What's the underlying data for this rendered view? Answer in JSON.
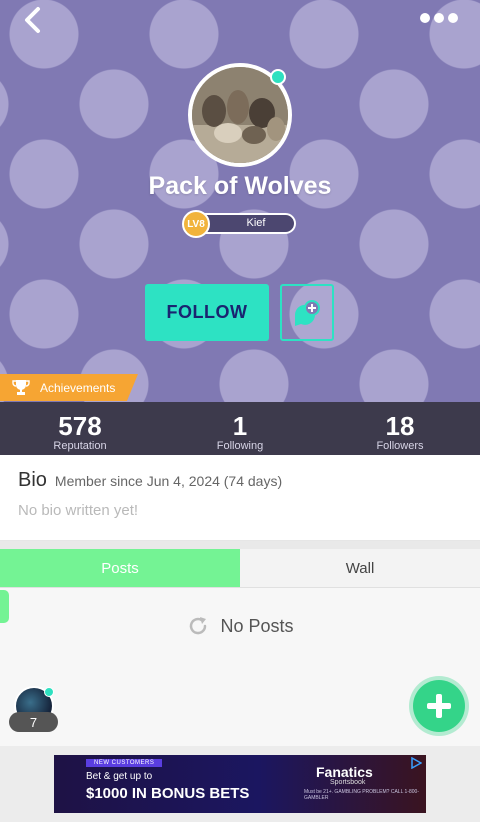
{
  "profile": {
    "name": "Pack of Wolves",
    "level_badge": "LV8",
    "level_title": "Kief",
    "online": true
  },
  "actions": {
    "follow_label": "FOLLOW"
  },
  "achievements": {
    "label": "Achievements"
  },
  "stats": [
    {
      "value": "578",
      "label": "Reputation"
    },
    {
      "value": "1",
      "label": "Following"
    },
    {
      "value": "18",
      "label": "Followers"
    }
  ],
  "bio": {
    "title": "Bio",
    "member_since": "Member since Jun 4, 2024 (74 days)",
    "text": "No bio written yet!"
  },
  "tabs": [
    {
      "label": "Posts",
      "active": true
    },
    {
      "label": "Wall",
      "active": false
    }
  ],
  "posts": {
    "empty_text": "No Posts"
  },
  "live": {
    "count": "7"
  },
  "ad": {
    "tag": "NEW CUSTOMERS",
    "line1": "Bet & get up to",
    "line2": "$1000 IN BONUS BETS",
    "brand": "Fanatics",
    "brand_sub": "Sportsbook",
    "fine_print": "Must be 21+. GAMBLING PROBLEM? CALL 1-800-GAMBLER"
  },
  "colors": {
    "hero_bg": "#8079b3",
    "dot": "#a9a3cf",
    "accent_teal": "#2de2c3",
    "posts_tab": "#74f394",
    "achievements": "#f6a533",
    "fab": "#34d489"
  },
  "icons": {
    "back": "chevron-left-icon",
    "more": "more-dots-icon",
    "chat": "chat-plus-icon",
    "trophy": "trophy-icon",
    "refresh": "refresh-icon",
    "fab": "plus-icon"
  }
}
